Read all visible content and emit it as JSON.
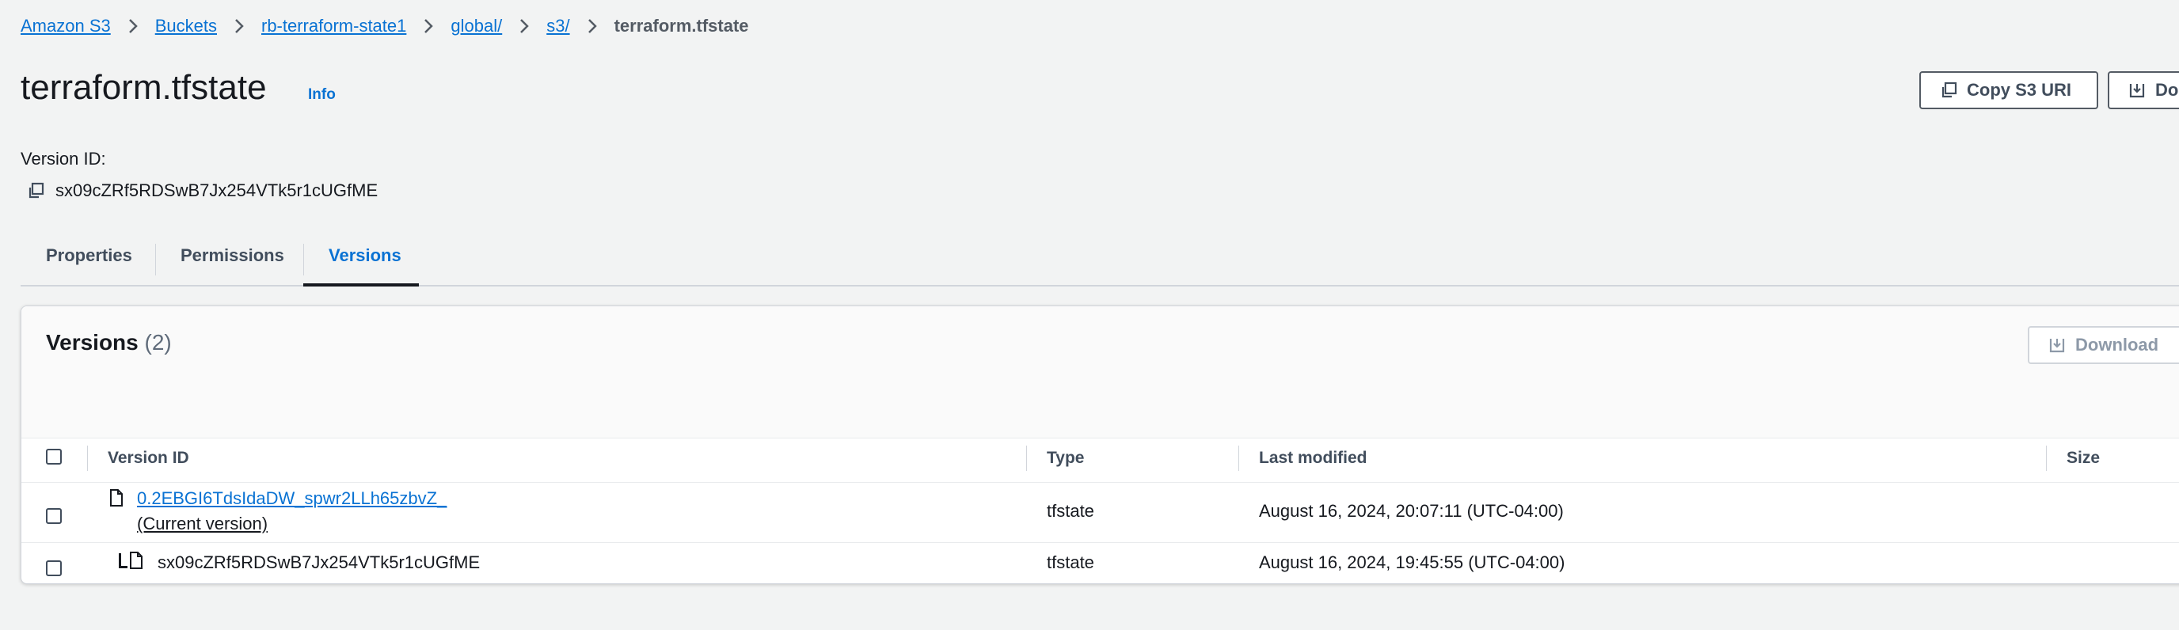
{
  "breadcrumb": {
    "items": [
      "Amazon S3",
      "Buckets",
      "rb-terraform-state1",
      "global/",
      "s3/"
    ],
    "current": "terraform.tfstate"
  },
  "header": {
    "title": "terraform.tfstate",
    "info_label": "Info",
    "copy_uri_label": "Copy S3 URI",
    "download_label": "Do"
  },
  "version_section": {
    "label": "Version ID:",
    "value": "sx09cZRf5RDSwB7Jx254VTk5r1cUGfME"
  },
  "tabs": [
    {
      "label": "Properties",
      "active": false
    },
    {
      "label": "Permissions",
      "active": false
    },
    {
      "label": "Versions",
      "active": true
    }
  ],
  "versions_panel": {
    "title": "Versions",
    "count": "(2)",
    "download_label": "Download",
    "columns": [
      "Version ID",
      "Type",
      "Last modified",
      "Size"
    ],
    "rows": [
      {
        "version_id": "0.2EBGI6TdsIdaDW_spwr2LLh65zbvZ_",
        "note": "(Current version)",
        "type": "tfstate",
        "last_modified": "August 16, 2024, 20:07:11 (UTC-04:00)"
      },
      {
        "version_id": "sx09cZRf5RDSwB7Jx254VTk5r1cUGfME",
        "type": "tfstate",
        "last_modified": "August 16, 2024, 19:45:55 (UTC-04:00)"
      }
    ]
  },
  "icons": {
    "chevron": "chevron-right-icon",
    "copy": "copy-icon",
    "download": "download-icon",
    "file": "file-icon"
  },
  "colors": {
    "link": "#0972d3",
    "background": "#f2f3f3",
    "panel": "#ffffff",
    "text": "#16191f"
  }
}
